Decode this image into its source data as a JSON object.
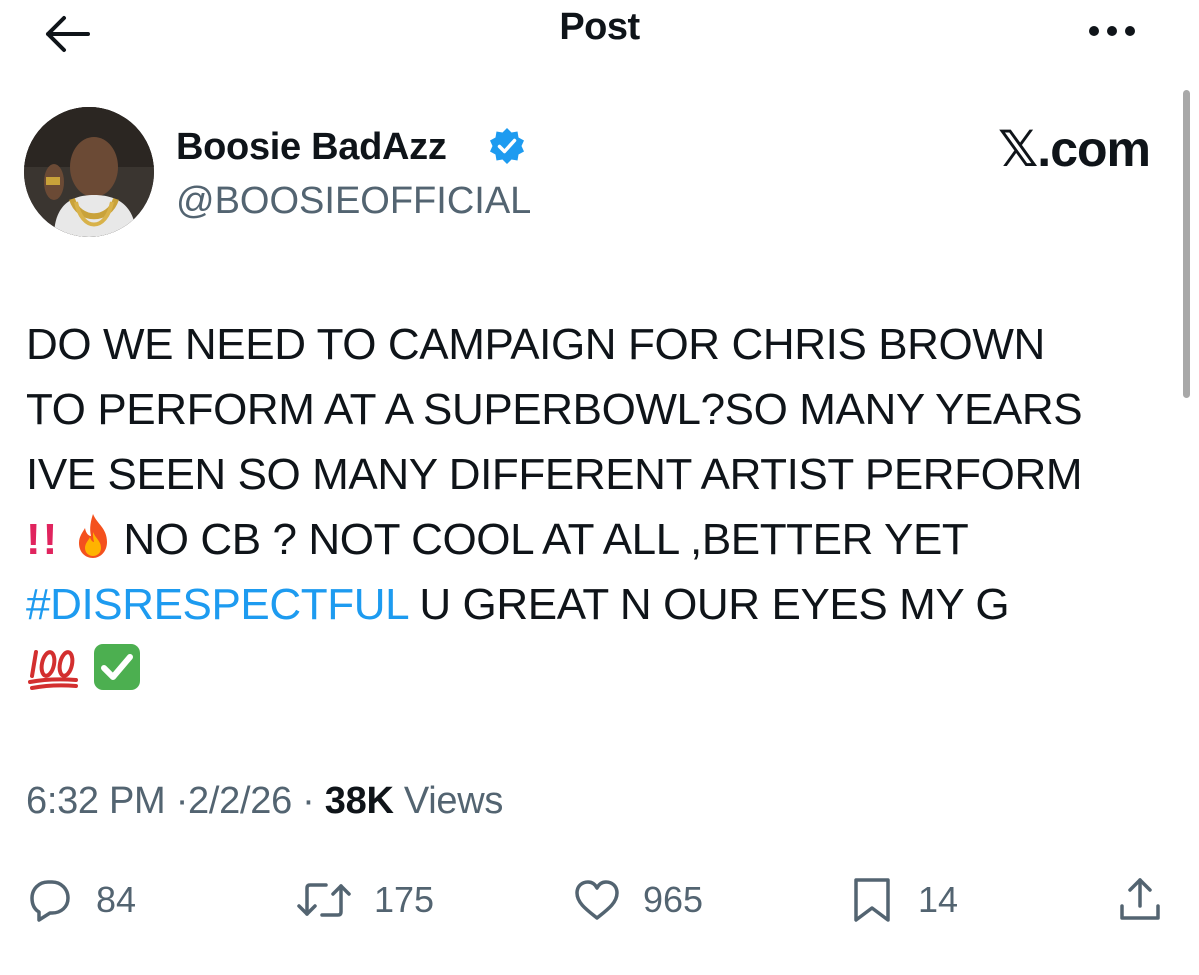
{
  "header": {
    "title": "Post",
    "back_icon": "arrow-left-icon",
    "more_icon": "more-horizontal-icon"
  },
  "post": {
    "author": {
      "display_name": "Boosie BadAzz",
      "handle": "@BOOSIEOFFICIAL",
      "verified_icon": "verified-badge-icon",
      "verified_color": "#1d9bf0"
    },
    "watermark": "𝕏.com",
    "text": {
      "line1": "DO WE NEED TO CAMPAIGN FOR CHRIS BROWN",
      "line2": "TO PERFORM AT A SUPERBOWL?SO MANY YEARS",
      "line3": "IVE SEEN SO MANY DIFFERENT ARTIST PERFORM",
      "line4_emoji1": "!!",
      "line4_text": "NO CB ? NOT COOL AT ALL ,BETTER YET",
      "hashtag": "#DISRESPECTFUL",
      "line5_text": " U GREAT N OUR EYES MY G"
    },
    "emojis": [
      "double-exclamation-icon",
      "fire-icon",
      "hundred-points-icon",
      "check-mark-button-icon"
    ],
    "time": "6:32 PM",
    "separator": "·",
    "date": "2/2/26",
    "views_count": "38K",
    "views_label": "Views",
    "hashtag_color": "#1d9bf0"
  },
  "actions": {
    "reply": {
      "icon": "reply-icon",
      "count": "84"
    },
    "repost": {
      "icon": "repost-icon",
      "count": "175"
    },
    "like": {
      "icon": "heart-icon",
      "count": "965"
    },
    "bookmark": {
      "icon": "bookmark-icon",
      "count": "14"
    },
    "share": {
      "icon": "share-icon"
    }
  }
}
